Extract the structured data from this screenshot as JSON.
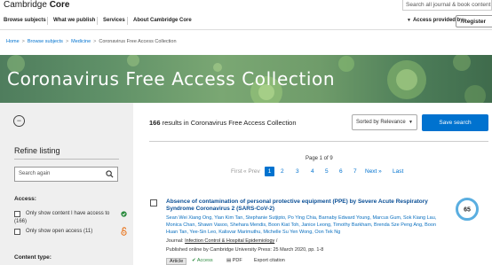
{
  "header": {
    "logo_regular": "Cambridge ",
    "logo_bold": "Core",
    "site_search_placeholder": "Search all journal & book content"
  },
  "nav": {
    "items": [
      "Browse subjects",
      "What we publish",
      "Services",
      "About Cambridge Core"
    ],
    "access_provided_by": "Access provided by",
    "register": "Register"
  },
  "breadcrumb": {
    "items": [
      "Home",
      "Browse subjects",
      "Medicine",
      "Coronavirus Free Access Collection"
    ],
    "separator": ">"
  },
  "banner": {
    "title": "Coronavirus Free Access Collection"
  },
  "sidebar": {
    "collapse_symbol": "−",
    "refine_title": "Refine listing",
    "search_placeholder": "Search again",
    "access_title": "Access:",
    "options": [
      {
        "label": "Only show content I have access to",
        "count": "(166)"
      },
      {
        "label": "Only show open access (11)"
      }
    ],
    "content_type_title": "Content type:"
  },
  "results": {
    "count": "166",
    "count_suffix": " results in Coronavirus Free Access Collection",
    "sort_label": "Sorted by Relevance",
    "save_search": "Save search",
    "page_info": "Page 1 of 9",
    "pager": {
      "first": "First",
      "prev": "« Prev",
      "pages": [
        "1",
        "2",
        "3",
        "4",
        "5",
        "6",
        "7"
      ],
      "current": "1",
      "next": "Next »",
      "last": "Last"
    }
  },
  "result_item": {
    "title": "Absence of contamination of personal protective equipment (PPE) by Severe Acute Respiratory Syndrome Coronavirus 2 (SARS-CoV-2)",
    "authors": "Sean Wei Xiang Ong, Yian Kim Tan, Stephanie Sutjipto, Po Ying Chia, Barnaby Edward Young, Marcus Gum, Sok Kiang Lau, Monica Chan, Shawn Vasoo, Shehara Mendis, Boon Kiat Toh, Janice Leong, Timothy Barkham, Brenda Sze Peng Ang, Boon Huan Tan, Yee-Sin Leo, Kalisvar Marimuthu, Michelle Su Yen Wong, Oon Tek Ng",
    "journal_prefix": "Journal: ",
    "journal": "Infection Control & Hospital Epidemiology",
    "journal_suffix": " /",
    "published": "Published online by Cambridge University Press: 25 March 2020, pp. 1-8",
    "tags": {
      "article": "Article",
      "access": "Access",
      "pdf": "PDF",
      "export": "Export citation"
    },
    "altmetric_score": "65"
  },
  "colors": {
    "accent": "#0072cf",
    "banner_green": "#6f9c6a",
    "sidebar_bg": "#efefef",
    "open_access_orange": "#e8731a",
    "access_green": "#2b8a3e"
  },
  "icons": {
    "site_search": "search-icon",
    "sidebar_search": "search-icon",
    "access": "check-circle-icon",
    "open_access": "open-access-lock-icon",
    "pdf": "pdf-icon",
    "export": "export-icon"
  }
}
